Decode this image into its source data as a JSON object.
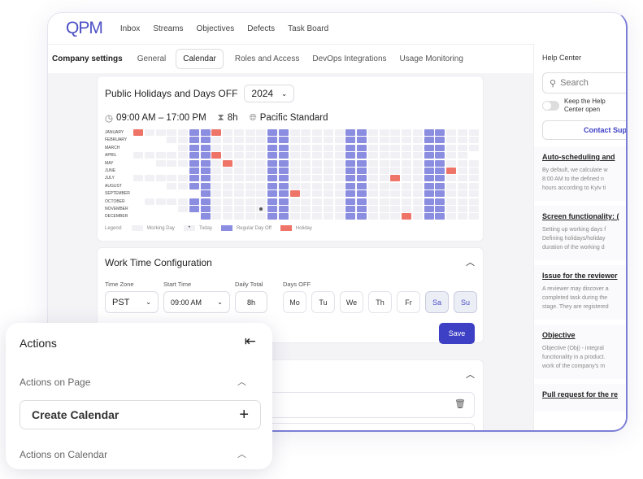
{
  "app": {
    "logo": "QPM",
    "nav": [
      "Inbox",
      "Streams",
      "Objectives",
      "Defects",
      "Task Board"
    ]
  },
  "settings": {
    "title": "Company settings",
    "tabs": [
      "General",
      "Calendar",
      "Roles and Access",
      "DevOps Integrations",
      "Usage Monitoring"
    ],
    "active_tab": "Calendar"
  },
  "holidays": {
    "title": "Public Holidays and Days OFF",
    "year": "2024",
    "hours": "09:00 AM – 17:00 PM",
    "total": "8h",
    "timezone": "Pacific Standard",
    "months": [
      "JANUARY",
      "FEBRUARY",
      "MARCH",
      "APRIL",
      "MAY",
      "JUNE",
      "JULY",
      "AUGUST",
      "SEPTEMBER",
      "OCTOBER",
      "NOVEMBER",
      "DECEMBER"
    ],
    "holiday_dates": [
      [
        1,
        1
      ],
      [
        1,
        8
      ],
      [
        4,
        8
      ],
      [
        5,
        7
      ],
      [
        6,
        24
      ],
      [
        7,
        24
      ],
      [
        9,
        9
      ],
      [
        12,
        19
      ]
    ],
    "today": [
      11,
      8
    ],
    "legend": {
      "label": "Legend:",
      "working": "Working Day",
      "today": "Today",
      "dayoff": "Regular Day Off",
      "holiday": "Holiday"
    },
    "colors": {
      "working": "#f1f1f5",
      "dayoff": "#8b8de0",
      "holiday": "#ee7468",
      "today": "#555555"
    }
  },
  "worktime": {
    "title": "Work Time Configuration",
    "tz_label": "Time Zone",
    "tz": "PST",
    "start_label": "Start Time",
    "start": "09:00 AM",
    "daily_label": "Daily Total",
    "daily": "8h",
    "days_label": "Days OFF",
    "days": [
      "Mo",
      "Tu",
      "We",
      "Th",
      "Fr",
      "Sa",
      "Su"
    ],
    "days_off": [
      "Sa",
      "Su"
    ],
    "save": "Save"
  },
  "help": {
    "title": "Help Center",
    "search_placeholder": "Search",
    "keep": "Keep the Help Center open",
    "contact": "Contact Support",
    "articles": [
      {
        "title": "Auto-scheduling and",
        "text": "By default, we calculate w\n8:00 AM to the defined n\nhours according to Kyiv ti"
      },
      {
        "title": "Screen functionality: (",
        "text": "Setting up working days f\nDefining holidays/holiday\nduration of the working d"
      },
      {
        "title": "Issue for the reviewer",
        "text": "A reviewer may discover a\ncompleted task during the\nstage. They are registered"
      },
      {
        "title": "Objective",
        "text": "Objective (Obj) - integral\nfunctionality in a product.\nwork of the company's m"
      },
      {
        "title": "Pull request for the re",
        "text": ""
      }
    ]
  },
  "actions": {
    "title": "Actions",
    "page_section": "Actions on Page",
    "create": "Create Calendar",
    "calendar_section": "Actions on Calendar"
  },
  "accent": "#3d3fc4"
}
